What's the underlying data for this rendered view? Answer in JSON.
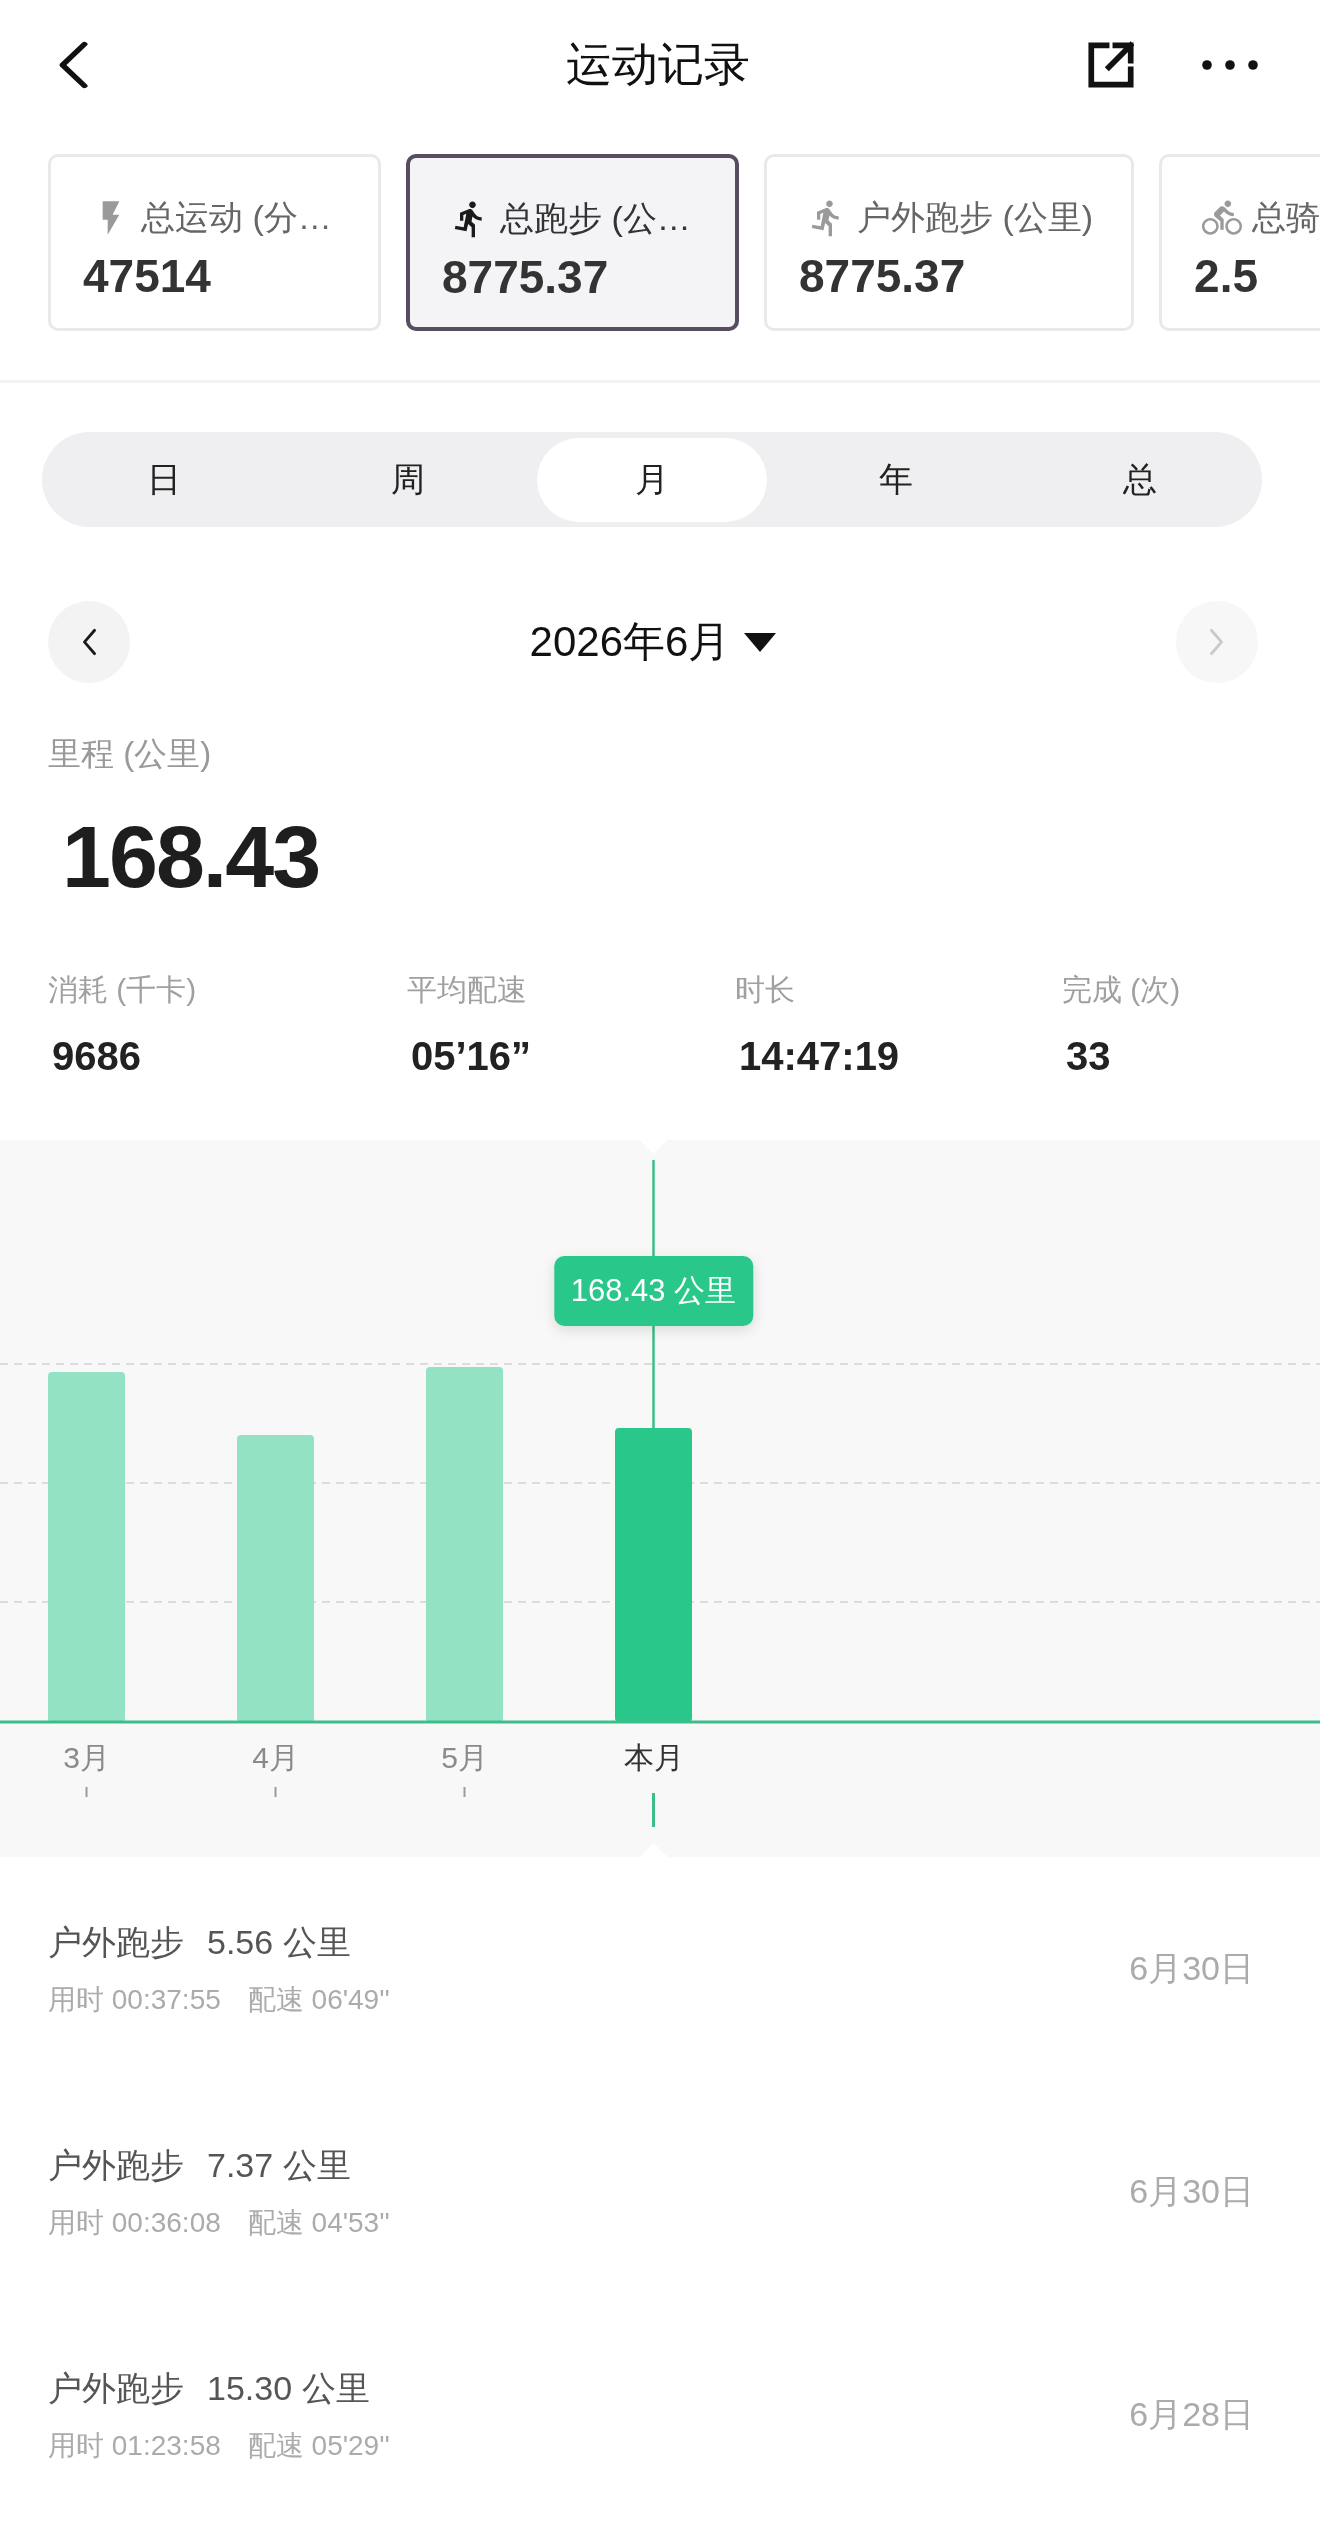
{
  "top_bar": {
    "title": "运动记录"
  },
  "cards": [
    {
      "kind": "bolt",
      "label": "总运动 (分…",
      "value": "47514",
      "selected": false
    },
    {
      "kind": "run",
      "label": "总跑步 (公…",
      "value": "8775.37",
      "selected": true
    },
    {
      "kind": "run",
      "label": "户外跑步 (公里)",
      "value": "8775.37",
      "selected": false
    },
    {
      "kind": "bike",
      "label": "总骑",
      "value": "2.5",
      "selected": false
    }
  ],
  "tabs": [
    {
      "label": "日",
      "selected": false
    },
    {
      "label": "周",
      "selected": false
    },
    {
      "label": "月",
      "selected": true
    },
    {
      "label": "年",
      "selected": false
    },
    {
      "label": "总",
      "selected": false
    }
  ],
  "date_nav": {
    "label": "2026年6月",
    "previous": {
      "disabled": false
    },
    "next": {
      "disabled": true
    }
  },
  "mileage": {
    "label": "里程 (公里)",
    "value": "168.43"
  },
  "stats": [
    {
      "label": "消耗 (千卡)",
      "value": "9686"
    },
    {
      "label": "平均配速",
      "value": "05’16”"
    },
    {
      "label": "时长",
      "value": "14:47:19"
    },
    {
      "label": "完成 (次)",
      "value": "33"
    }
  ],
  "chart": {
    "tooltip": "168.43 公里",
    "bars": [
      {
        "label": "3月",
        "selected": false
      },
      {
        "label": "4月",
        "selected": false
      },
      {
        "label": "5月",
        "selected": false
      },
      {
        "label": "本月",
        "selected": true
      }
    ]
  },
  "records": [
    {
      "type": "户外跑步",
      "distance": "5.56 公里",
      "duration": "用时 00:37:55",
      "pace": "配速 06'49''",
      "date": "6月30日"
    },
    {
      "type": "户外跑步",
      "distance": "7.37 公里",
      "duration": "用时 00:36:08",
      "pace": "配速 04'53''",
      "date": "6月30日"
    },
    {
      "type": "户外跑步",
      "distance": "15.30 公里",
      "duration": "用时 01:23:58",
      "pace": "配速 05'29''",
      "date": "6月28日"
    }
  ]
}
